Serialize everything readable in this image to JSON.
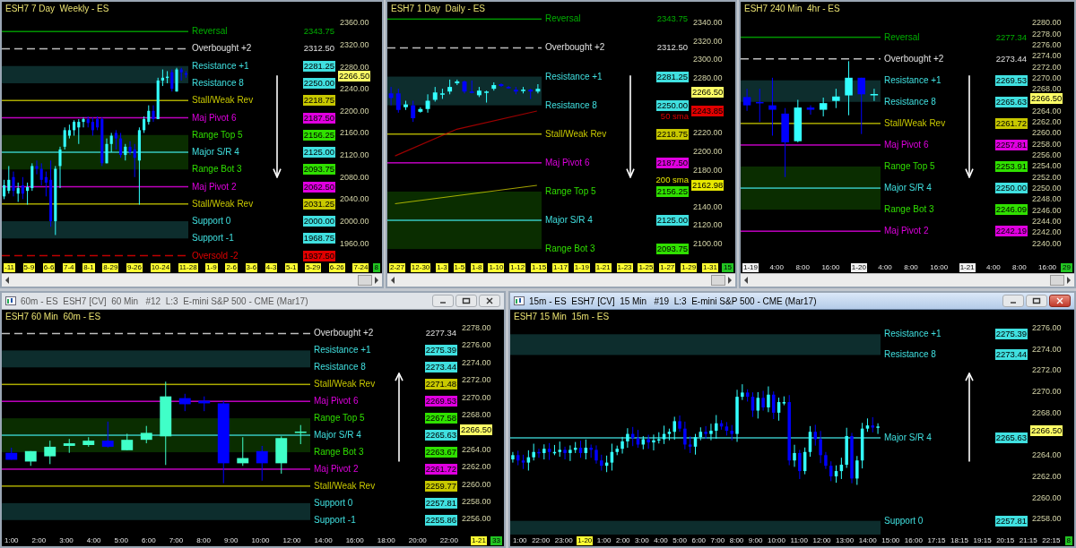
{
  "top_windows": [
    {
      "chart_title": "ESH7 7 Day  Weekly - ES",
      "arrow": {
        "kind": "down"
      },
      "scrollbar": true,
      "price": "2266.50",
      "bar_count": "8",
      "ticks": [
        "2360.00",
        "2320.00",
        "2280.00",
        "2240.00",
        "2200.00",
        "2160.00",
        "2120.00",
        "2080.00",
        "2040.00",
        "2000.00",
        "1960.00"
      ],
      "levels": [
        {
          "label": "Reversal",
          "value": "2343.75",
          "kind": "line",
          "color": "#00b000",
          "badge": false
        },
        {
          "label": "Overbought +2",
          "value": "2312.50",
          "kind": "dashed",
          "color": "#e0e0e0",
          "badge": false
        },
        {
          "label": "Resistance +1",
          "value": "2281.25",
          "kind": "zone-top",
          "color": "#40e0e0",
          "badge": true
        },
        {
          "label": "Resistance 8",
          "value": "2250.00",
          "kind": "zone-bottom",
          "color": "#40e0e0",
          "badge": true
        },
        {
          "label": "Stall/Weak Rev",
          "value": "2218.75",
          "kind": "line",
          "color": "#c8c800",
          "badge": true
        },
        {
          "label": "Maj Pivot 6",
          "value": "2187.50",
          "kind": "line",
          "color": "#e000e0",
          "badge": true
        },
        {
          "label": "Range Top 5",
          "value": "2156.25",
          "kind": "zone-top",
          "color": "#30e000",
          "badge": true
        },
        {
          "label": "Major S/R 4",
          "value": "2125.00",
          "kind": "line",
          "color": "#40e0e0",
          "badge": true
        },
        {
          "label": "Range Bot 3",
          "value": "2093.75",
          "kind": "zone-bottom",
          "color": "#30e000",
          "badge": true
        },
        {
          "label": "Maj Pivot 2",
          "value": "2062.50",
          "kind": "line",
          "color": "#e000e0",
          "badge": true
        },
        {
          "label": "Stall/Weak Rev",
          "value": "2031.25",
          "kind": "line",
          "color": "#c8c800",
          "badge": true
        },
        {
          "label": "Support 0",
          "value": "2000.00",
          "kind": "zone-top",
          "color": "#40e0e0",
          "badge": true
        },
        {
          "label": "Support -1",
          "value": "1968.75",
          "kind": "zone-bottom",
          "color": "#40e0e0",
          "badge": true
        },
        {
          "label": "Oversold -2",
          "value": "1937.50",
          "kind": "dashed",
          "color": "#e00000",
          "badge": true
        }
      ],
      "x_axis": [
        {
          "text": "-11",
          "kind": "date"
        },
        {
          "text": "5-9",
          "kind": "date"
        },
        {
          "text": "6-6",
          "kind": "date"
        },
        {
          "text": "7-4",
          "kind": "date"
        },
        {
          "text": "8-1",
          "kind": "date"
        },
        {
          "text": "8-29",
          "kind": "date"
        },
        {
          "text": "9-26",
          "kind": "date"
        },
        {
          "text": "10-24",
          "kind": "date"
        },
        {
          "text": "11-28",
          "kind": "date"
        },
        {
          "text": "1-9",
          "kind": "date"
        },
        {
          "text": "2-6",
          "kind": "date"
        },
        {
          "text": "3-6",
          "kind": "date"
        },
        {
          "text": "4-3",
          "kind": "date"
        },
        {
          "text": "5-1",
          "kind": "date"
        },
        {
          "text": "5-29",
          "kind": "date"
        },
        {
          "text": "6-26",
          "kind": "date"
        },
        {
          "text": "7-24",
          "kind": "date"
        }
      ]
    },
    {
      "chart_title": "ESH7 1 Day  Daily - ES",
      "arrow": {
        "kind": "down"
      },
      "scrollbar": true,
      "price": "2266.50",
      "bar_count": "15",
      "ticks": [
        "2340.00",
        "2320.00",
        "2300.00",
        "2280.00",
        "2220.00",
        "2200.00",
        "2180.00",
        "2140.00",
        "2120.00",
        "2100.00"
      ],
      "levels": [
        {
          "label": "Reversal",
          "value": "2343.75",
          "kind": "line",
          "color": "#00b000",
          "badge": false
        },
        {
          "label": "Overbought +2",
          "value": "2312.50",
          "kind": "dashed",
          "color": "#e0e0e0",
          "badge": false
        },
        {
          "label": "Resistance +1",
          "value": "2281.25",
          "kind": "zone-top",
          "color": "#40e0e0",
          "badge": true
        },
        {
          "label": "Resistance 8",
          "value": "2250.00",
          "kind": "zone-bottom",
          "color": "#40e0e0",
          "badge": true
        },
        {
          "label": "Stall/Weak Rev",
          "value": "2218.75",
          "kind": "line",
          "color": "#c8c800",
          "badge": true
        },
        {
          "label": "Maj Pivot 6",
          "value": "2187.50",
          "kind": "line",
          "color": "#e000e0",
          "badge": true
        },
        {
          "label": "Range Top 5",
          "value": "2156.25",
          "kind": "zone-top",
          "color": "#30e000",
          "badge": true
        },
        {
          "label": "Major S/R 4",
          "value": "2125.00",
          "kind": "line",
          "color": "#40e0e0",
          "badge": true
        },
        {
          "label": "Range Bot 3",
          "value": "2093.75",
          "kind": "zone-bottom",
          "color": "#30e000",
          "badge": true
        }
      ],
      "indicators": [
        {
          "label": "50 sma",
          "value": "2243.85",
          "color": "#e00000"
        },
        {
          "label": "200 sma",
          "value": "2162.98",
          "color": "#e8e800"
        }
      ],
      "x_axis": [
        {
          "text": "2-27",
          "kind": "date"
        },
        {
          "text": "12-30",
          "kind": "date"
        },
        {
          "text": "1-3",
          "kind": "date"
        },
        {
          "text": "1-5",
          "kind": "date"
        },
        {
          "text": "1-8",
          "kind": "date"
        },
        {
          "text": "1-10",
          "kind": "date"
        },
        {
          "text": "1-12",
          "kind": "date"
        },
        {
          "text": "1-15",
          "kind": "date"
        },
        {
          "text": "1-17",
          "kind": "date"
        },
        {
          "text": "1-19",
          "kind": "date"
        },
        {
          "text": "1-21",
          "kind": "date"
        },
        {
          "text": "1-23",
          "kind": "date"
        },
        {
          "text": "1-25",
          "kind": "date"
        },
        {
          "text": "1-27",
          "kind": "date"
        },
        {
          "text": "1-29",
          "kind": "date"
        },
        {
          "text": "1-31",
          "kind": "date"
        }
      ]
    },
    {
      "chart_title": "ESH7 240 Min  4hr - ES",
      "arrow": {
        "kind": "down"
      },
      "scrollbar": true,
      "price": "2266.50",
      "bar_count": "29",
      "ticks": [
        "2280.00",
        "2278.00",
        "2276.00",
        "2274.00",
        "2272.00",
        "2270.00",
        "2268.00",
        "2264.00",
        "2262.00",
        "2260.00",
        "2258.00",
        "2256.00",
        "2254.00",
        "2252.00",
        "2250.00",
        "2248.00",
        "2246.00",
        "2244.00",
        "2242.00",
        "2240.00"
      ],
      "levels": [
        {
          "label": "Reversal",
          "value": "2277.34",
          "kind": "line",
          "color": "#00b000",
          "badge": false
        },
        {
          "label": "Overbought +2",
          "value": "2273.44",
          "kind": "dashed",
          "color": "#e0e0e0",
          "badge": false
        },
        {
          "label": "Resistance +1",
          "value": "2269.53",
          "kind": "zone-top",
          "color": "#40e0e0",
          "badge": true
        },
        {
          "label": "Resistance 8",
          "value": "2265.63",
          "kind": "zone-bottom",
          "color": "#40e0e0",
          "badge": true
        },
        {
          "label": "Stall/Weak Rev",
          "value": "2261.72",
          "kind": "line",
          "color": "#c8c800",
          "badge": true
        },
        {
          "label": "Maj Pivot 6",
          "value": "2257.81",
          "kind": "line",
          "color": "#e000e0",
          "badge": true
        },
        {
          "label": "Range Top 5",
          "value": "2253.91",
          "kind": "zone-top",
          "color": "#30e000",
          "badge": true
        },
        {
          "label": "Major S/R 4",
          "value": "2250.00",
          "kind": "line",
          "color": "#40e0e0",
          "badge": true
        },
        {
          "label": "Range Bot 3",
          "value": "2246.09",
          "kind": "zone-bottom",
          "color": "#30e000",
          "badge": true
        },
        {
          "label": "Maj Pivot 2",
          "value": "2242.19",
          "kind": "line",
          "color": "#e000e0",
          "badge": true
        }
      ],
      "x_axis": [
        {
          "text": "1-19",
          "kind": "session"
        },
        {
          "text": "4:00",
          "kind": "time"
        },
        {
          "text": "8:00",
          "kind": "time"
        },
        {
          "text": "16:00",
          "kind": "time"
        },
        {
          "text": "1-20",
          "kind": "session"
        },
        {
          "text": "4:00",
          "kind": "time"
        },
        {
          "text": "8:00",
          "kind": "time"
        },
        {
          "text": "16:00",
          "kind": "time"
        },
        {
          "text": "1-21",
          "kind": "session"
        },
        {
          "text": "4:00",
          "kind": "time"
        },
        {
          "text": "8:00",
          "kind": "time"
        },
        {
          "text": "16:00",
          "kind": "time"
        }
      ]
    }
  ],
  "bottom_windows": [
    {
      "title_bar": {
        "title": "60m - ES  ESH7 [CV]  60 Min   #12  L:3  E-mini S&P 500 - CME (Mar17)",
        "active": false
      },
      "chart_title": "ESH7 60 Min  60m - ES",
      "arrow": {
        "kind": "up"
      },
      "scrollbar": false,
      "price": "2266.50",
      "bar_count": "33",
      "ticks": [
        "2278.00",
        "2276.00",
        "2274.00",
        "2272.00",
        "2270.00",
        "2268.00",
        "2264.00",
        "2262.00",
        "2260.00",
        "2258.00",
        "2256.00"
      ],
      "levels": [
        {
          "label": "Overbought +2",
          "value": "2277.34",
          "kind": "dashed",
          "color": "#e0e0e0",
          "badge": false
        },
        {
          "label": "Resistance +1",
          "value": "2275.39",
          "kind": "zone-top",
          "color": "#40e0e0",
          "badge": true
        },
        {
          "label": "Resistance 8",
          "value": "2273.44",
          "kind": "zone-bottom",
          "color": "#40e0e0",
          "badge": true
        },
        {
          "label": "Stall/Weak Rev",
          "value": "2271.48",
          "kind": "line",
          "color": "#c8c800",
          "badge": true
        },
        {
          "label": "Maj Pivot 6",
          "value": "2269.53",
          "kind": "line",
          "color": "#e000e0",
          "badge": true
        },
        {
          "label": "Range Top 5",
          "value": "2267.58",
          "kind": "zone-top",
          "color": "#30e000",
          "badge": true
        },
        {
          "label": "Major S/R 4",
          "value": "2265.63",
          "kind": "line",
          "color": "#40e0e0",
          "badge": true
        },
        {
          "label": "Range Bot 3",
          "value": "2263.67",
          "kind": "zone-bottom",
          "color": "#30e000",
          "badge": true
        },
        {
          "label": "Maj Pivot 2",
          "value": "2261.72",
          "kind": "line",
          "color": "#e000e0",
          "badge": true
        },
        {
          "label": "Stall/Weak Rev",
          "value": "2259.77",
          "kind": "line",
          "color": "#c8c800",
          "badge": true
        },
        {
          "label": "Support 0",
          "value": "2257.81",
          "kind": "zone-top",
          "color": "#40e0e0",
          "badge": true
        },
        {
          "label": "Support -1",
          "value": "2255.86",
          "kind": "zone-bottom",
          "color": "#40e0e0",
          "badge": true
        }
      ],
      "x_axis": [
        {
          "text": "1:00",
          "kind": "time"
        },
        {
          "text": "2:00",
          "kind": "time"
        },
        {
          "text": "3:00",
          "kind": "time"
        },
        {
          "text": "4:00",
          "kind": "time"
        },
        {
          "text": "5:00",
          "kind": "time"
        },
        {
          "text": "6:00",
          "kind": "time"
        },
        {
          "text": "7:00",
          "kind": "time"
        },
        {
          "text": "8:00",
          "kind": "time"
        },
        {
          "text": "9:00",
          "kind": "time"
        },
        {
          "text": "10:00",
          "kind": "time"
        },
        {
          "text": "12:00",
          "kind": "time"
        },
        {
          "text": "14:00",
          "kind": "time"
        },
        {
          "text": "16:00",
          "kind": "time"
        },
        {
          "text": "18:00",
          "kind": "time"
        },
        {
          "text": "20:00",
          "kind": "time"
        },
        {
          "text": "22:00",
          "kind": "time"
        },
        {
          "text": "1-21",
          "kind": "date"
        }
      ]
    },
    {
      "title_bar": {
        "title": "15m - ES  ESH7 [CV]  15 Min   #19  L:3  E-mini S&P 500 - CME (Mar17)",
        "active": true
      },
      "chart_title": "ESH7 15 Min  15m - ES",
      "arrow": {
        "kind": "up"
      },
      "scrollbar": false,
      "price": "2266.50",
      "bar_count": "8",
      "ticks": [
        "2276.00",
        "2274.00",
        "2272.00",
        "2270.00",
        "2268.00",
        "2264.00",
        "2262.00",
        "2260.00",
        "2258.00"
      ],
      "levels": [
        {
          "label": "Resistance +1",
          "value": "2275.39",
          "kind": "zone-top",
          "color": "#40e0e0",
          "badge": true
        },
        {
          "label": "Resistance 8",
          "value": "2273.44",
          "kind": "zone-bottom",
          "color": "#40e0e0",
          "badge": true
        },
        {
          "label": "Major S/R 4",
          "value": "2265.63",
          "kind": "line",
          "color": "#40e0e0",
          "badge": true
        },
        {
          "label": "Support 0",
          "value": "2257.81",
          "kind": "zone-top",
          "color": "#40e0e0",
          "badge": true
        }
      ],
      "x_axis": [
        {
          "text": "1:00",
          "kind": "time"
        },
        {
          "text": "22:00",
          "kind": "time"
        },
        {
          "text": "23:00",
          "kind": "time"
        },
        {
          "text": "1-20",
          "kind": "date"
        },
        {
          "text": "1:00",
          "kind": "time"
        },
        {
          "text": "2:00",
          "kind": "time"
        },
        {
          "text": "3:00",
          "kind": "time"
        },
        {
          "text": "4:00",
          "kind": "time"
        },
        {
          "text": "5:00",
          "kind": "time"
        },
        {
          "text": "6:00",
          "kind": "time"
        },
        {
          "text": "7:00",
          "kind": "time"
        },
        {
          "text": "8:00",
          "kind": "time"
        },
        {
          "text": "9:00",
          "kind": "time"
        },
        {
          "text": "10:00",
          "kind": "time"
        },
        {
          "text": "11:00",
          "kind": "time"
        },
        {
          "text": "12:00",
          "kind": "time"
        },
        {
          "text": "13:00",
          "kind": "time"
        },
        {
          "text": "14:00",
          "kind": "time"
        },
        {
          "text": "15:00",
          "kind": "time"
        },
        {
          "text": "16:00",
          "kind": "time"
        },
        {
          "text": "17:15",
          "kind": "time"
        },
        {
          "text": "18:15",
          "kind": "time"
        },
        {
          "text": "19:15",
          "kind": "time"
        },
        {
          "text": "20:15",
          "kind": "time"
        },
        {
          "text": "21:15",
          "kind": "time"
        },
        {
          "text": "22:15",
          "kind": "time"
        }
      ]
    }
  ]
}
